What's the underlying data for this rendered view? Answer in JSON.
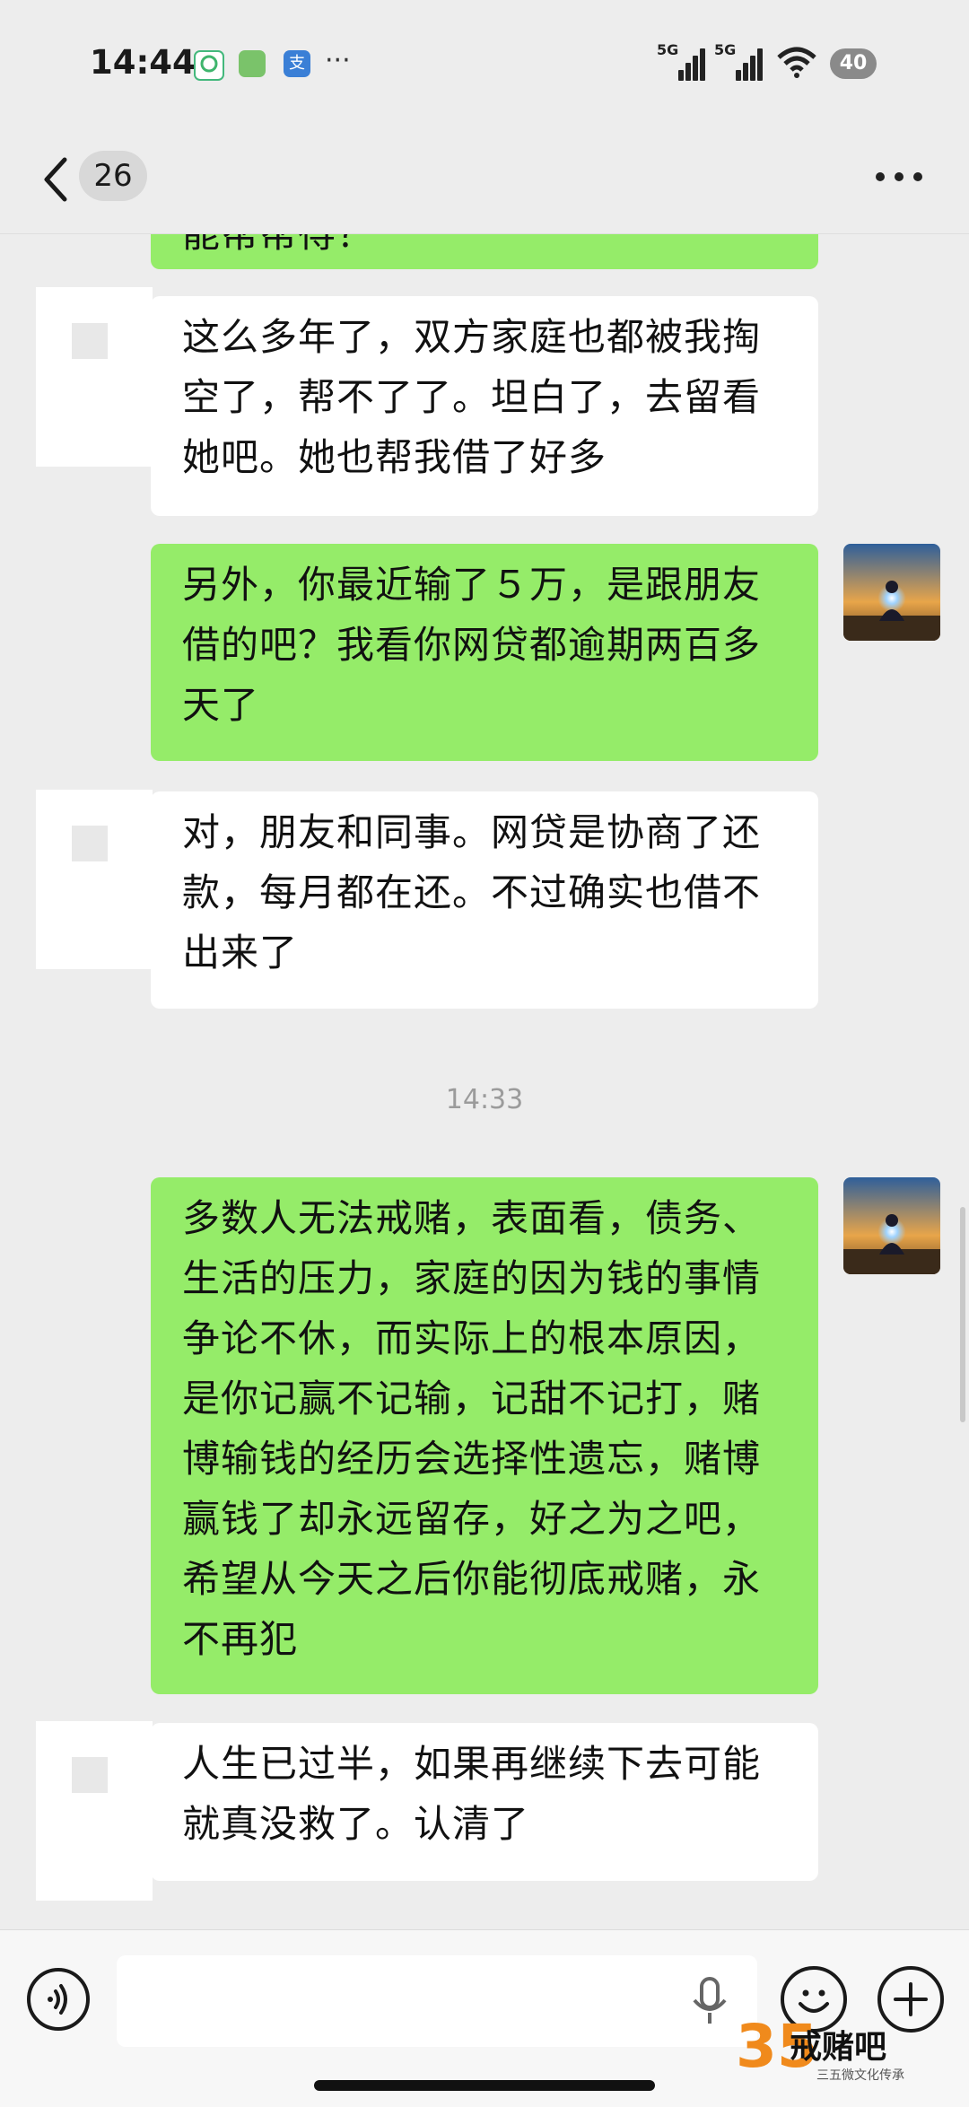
{
  "status_bar": {
    "time": "14:44",
    "apps": [
      "sync-icon",
      "app-icon",
      "alipay-icon"
    ],
    "alipay_label": "支",
    "more": "···",
    "signal_1_label": "5G",
    "signal_2_label": "5G",
    "battery": "40"
  },
  "nav": {
    "unread_count": "26"
  },
  "messages": [
    {
      "side": "out",
      "text": "能帮帮得？"
    },
    {
      "side": "in",
      "text": "这么多年了，双方家庭也都被我掏\n空了，帮不了了。坦白了，去留看\n她吧。她也帮我借了好多"
    },
    {
      "side": "out",
      "text": "另外，你最近输了５万，是跟朋友\n借的吧？我看你网贷都逾期两百多\n天了"
    },
    {
      "side": "in",
      "text": "对，朋友和同事。网贷是协商了还\n款，每月都在还。不过确实也借不\n出来了"
    },
    {
      "side": "out",
      "text": "多数人无法戒赌，表面看，债务、\n生活的压力，家庭的因为钱的事情\n争论不休，而实际上的根本原因，\n是你记赢不记输，记甜不记打，赌\n博输钱的经历会选择性遗忘，赌博\n赢钱了却永远留存，好之为之吧，\n希望从今天之后你能彻底戒赌，永\n不再犯"
    },
    {
      "side": "in",
      "text": "人生已过半，如果再继续下去可能\n就真没救了。认清了"
    }
  ],
  "timestamp": "14:33",
  "input": {
    "value": "",
    "placeholder": ""
  },
  "watermark": {
    "logo": "35",
    "title": "戒赌吧",
    "subtitle": "三五微文化传承"
  },
  "colors": {
    "outgoing_bubble": "#95ec69",
    "incoming_bubble": "#ffffff",
    "background": "#ededed"
  }
}
